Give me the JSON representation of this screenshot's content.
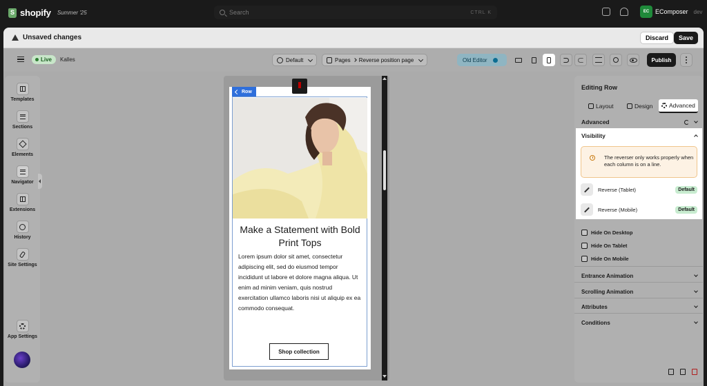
{
  "topbar": {
    "brand": "shopify",
    "season": "Summer '25",
    "search_placeholder": "Search",
    "search_shortcut": "CTRL K",
    "app_badge": "EC",
    "user_name": "EComposer",
    "user_role": "dev"
  },
  "unsaved": {
    "title": "Unsaved changes",
    "discard": "Discard",
    "save": "Save"
  },
  "toolbar": {
    "status": "Live",
    "store": "Kalles",
    "theme": "Default",
    "pages": "Pages",
    "page_name": "Reverse position page",
    "old_editor": "Old Editor",
    "publish": "Publish",
    "active_device": "mobile"
  },
  "sidebar": {
    "items": [
      {
        "label": "Templates",
        "icon": "grid-icon"
      },
      {
        "label": "Sections",
        "icon": "sections-icon"
      },
      {
        "label": "Elements",
        "icon": "cube-icon"
      },
      {
        "label": "Navigator",
        "icon": "list-icon"
      },
      {
        "label": "Extensions",
        "icon": "extensions-icon"
      },
      {
        "label": "History",
        "icon": "clock-icon"
      },
      {
        "label": "Site Settings",
        "icon": "brush-icon"
      }
    ],
    "app_settings": "App Settings"
  },
  "canvas": {
    "row_tag": "Row",
    "heading": "Make a Statement with Bold Print Tops",
    "body": "Lorem ipsum dolor sit amet, consectetur adipiscing elit, sed do eiusmod tempor incididunt ut labore et dolore magna aliqua. Ut enim ad minim veniam, quis nostrud exercitation ullamco laboris nisi ut aliquip ex ea commodo consequat.",
    "button": "Shop collection"
  },
  "panel": {
    "title": "Editing Row",
    "tabs": [
      {
        "label": "Layout"
      },
      {
        "label": "Design"
      },
      {
        "label": "Advanced"
      }
    ],
    "active_tab": "Advanced",
    "advanced_label": "Advanced",
    "visibility": {
      "title": "Visibility",
      "notice": "The reverser only works properly when each column is on a line.",
      "rows": [
        {
          "label": "Reverse (Tablet)",
          "badge": "Default"
        },
        {
          "label": "Reverse (Mobile)",
          "badge": "Default"
        }
      ]
    },
    "hide": [
      {
        "label": "Hide On Desktop"
      },
      {
        "label": "Hide On Tablet"
      },
      {
        "label": "Hide On Mobile"
      }
    ],
    "sections": [
      {
        "label": "Entrance Animation"
      },
      {
        "label": "Scrolling Animation"
      },
      {
        "label": "Attributes"
      },
      {
        "label": "Conditions"
      }
    ]
  }
}
